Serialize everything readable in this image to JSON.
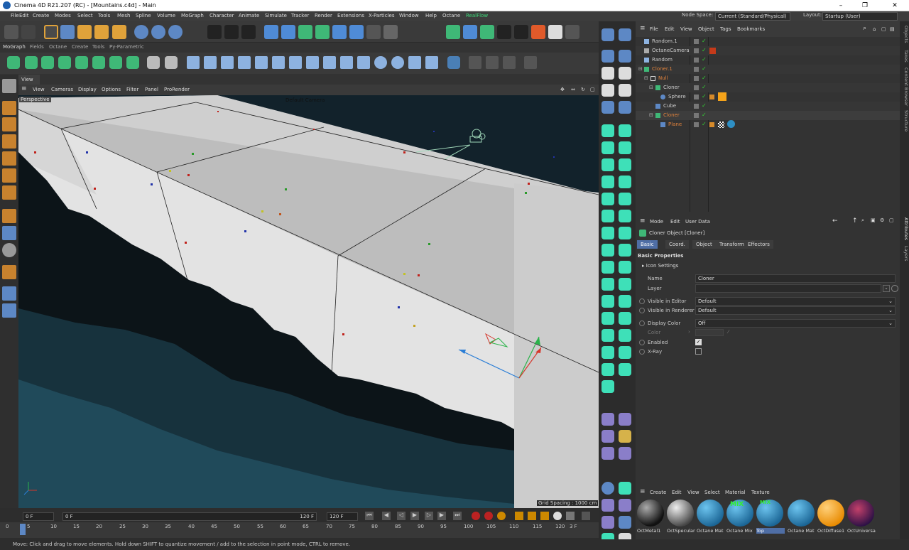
{
  "window": {
    "title": "Cinema 4D R21.207 (RC) - [Mountains.c4d] - Main",
    "controls": [
      "–",
      "❐",
      "✕"
    ]
  },
  "menu": {
    "items": [
      "File",
      "Edit",
      "Create",
      "Modes",
      "Select",
      "Tools",
      "Mesh",
      "Spline",
      "Volume",
      "MoGraph",
      "Character",
      "Animate",
      "Simulate",
      "Tracker",
      "Render",
      "Extensions",
      "X-Particles",
      "Window",
      "Help",
      "Octane",
      "RealFlow"
    ],
    "node_space_label": "Node Space:",
    "node_space_value": "Current (Standard/Physical)",
    "layout_label": "Layout:",
    "layout_value": "Startup (User)"
  },
  "palette": {
    "labels": [
      "MoGraph",
      "Fields",
      "Octane",
      "Create",
      "Tools",
      "Py-Parametric"
    ]
  },
  "view": {
    "tab": "View",
    "menu": [
      "View",
      "Cameras",
      "Display",
      "Options",
      "Filter",
      "Panel",
      "ProRender"
    ],
    "projection": "Perspective",
    "camera": "Default Camera",
    "grid_spacing": "Grid Spacing : 1000 cm"
  },
  "object_manager": {
    "menu": [
      "File",
      "Edit",
      "View",
      "Object",
      "Tags",
      "Bookmarks"
    ],
    "objects": [
      {
        "name": "Random.1",
        "color": "#dddddd"
      },
      {
        "name": "OctaneCamera",
        "color": "#dddddd"
      },
      {
        "name": "Random",
        "color": "#dddddd"
      },
      {
        "name": "Cloner.1",
        "color": "#e0823c"
      },
      {
        "name": "Null",
        "color": "#e0823c"
      },
      {
        "name": "Cloner",
        "color": "#dddddd"
      },
      {
        "name": "Sphere",
        "color": "#dddddd"
      },
      {
        "name": "Cube",
        "color": "#dddddd"
      },
      {
        "name": "Cloner",
        "color": "#e0823c"
      },
      {
        "name": "Plane",
        "color": "#e0823c"
      }
    ]
  },
  "side_tabs": [
    "Objects",
    "Takes",
    "Content Browser",
    "Structure",
    "Attributes",
    "Layers"
  ],
  "attributes": {
    "menu": [
      "Mode",
      "Edit",
      "User Data"
    ],
    "heading": "Cloner Object [Cloner]",
    "tabs": [
      "Basic",
      "Coord.",
      "Object",
      "Transform",
      "Effectors"
    ],
    "section": "Basic Properties",
    "icon_settings": "Icon Settings",
    "name_label": "Name",
    "name_value": "Cloner",
    "layer_label": "Layer",
    "vis_editor_label": "Visible in Editor",
    "vis_editor_value": "Default",
    "vis_renderer_label": "Visible in Renderer",
    "vis_renderer_value": "Default",
    "display_color_label": "Display Color",
    "display_color_value": "Off",
    "color_label": "Color",
    "enabled_label": "Enabled",
    "xray_label": "X-Ray"
  },
  "materials": {
    "menu": [
      "Create",
      "Edit",
      "View",
      "Select",
      "Material",
      "Texture"
    ],
    "items": [
      {
        "name": "OctMetal1",
        "color": "#2a2a2a"
      },
      {
        "name": "OctSpecular",
        "color": "#888888"
      },
      {
        "name": "Octane Mat",
        "color": "#2e8fc4"
      },
      {
        "name": "Octane Mix",
        "color": "#2e8fc4",
        "badge": "MIX"
      },
      {
        "name": "Top",
        "color": "#2e8fc4",
        "badge": "MIX"
      },
      {
        "name": "Octane Mat",
        "color": "#2e8fc4"
      },
      {
        "name": "OctDiffuse1",
        "color": "#f5a31a"
      },
      {
        "name": "OctUniversal",
        "color": "#6b2c8a"
      }
    ]
  },
  "timeline": {
    "start": "0 F",
    "current": "0 F",
    "end": "120 F",
    "max": "120 F",
    "frame_display": "3 F",
    "ticks": [
      "0",
      "5",
      "10",
      "15",
      "20",
      "25",
      "30",
      "35",
      "40",
      "45",
      "50",
      "55",
      "60",
      "65",
      "70",
      "75",
      "80",
      "85",
      "90",
      "95",
      "100",
      "105",
      "110",
      "115",
      "120"
    ]
  },
  "status": "Move: Click and drag to move elements. Hold down SHIFT to quantize movement / add to the selection in point mode, CTRL to remove."
}
